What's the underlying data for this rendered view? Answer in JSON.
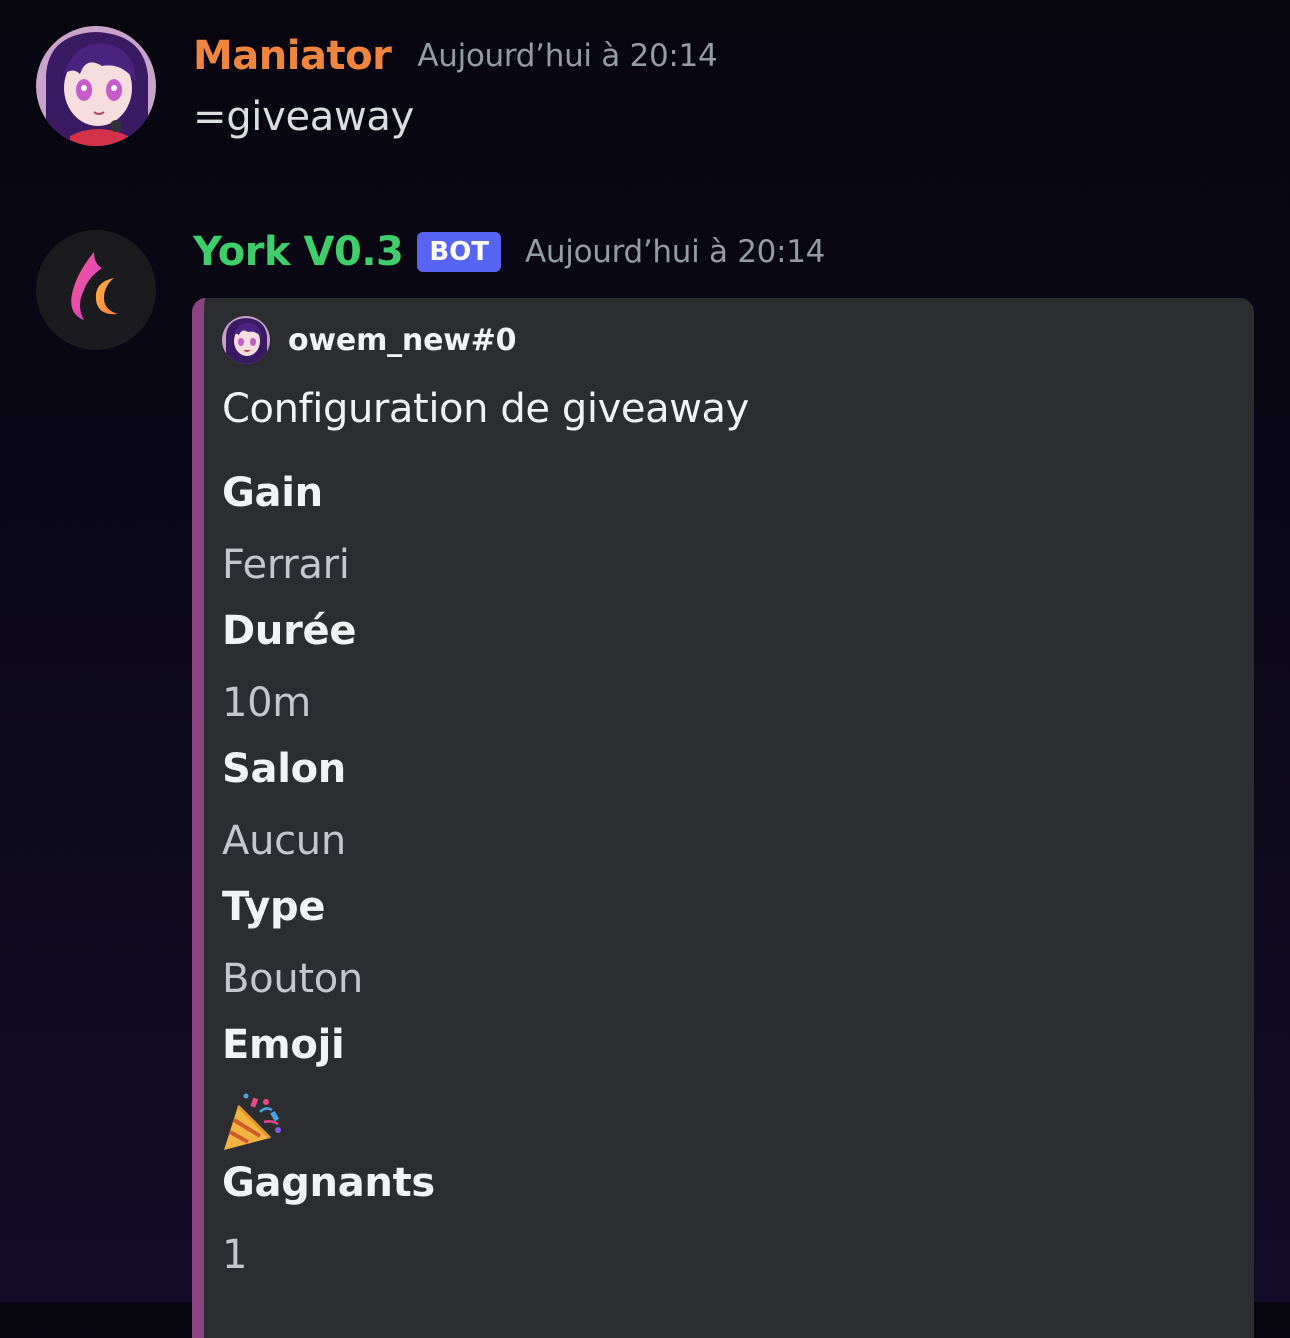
{
  "messages": {
    "user": {
      "username": "Maniator",
      "username_color": "#f0853e",
      "timestamp": "Aujourd’hui à 20:14",
      "content": "=giveaway",
      "avatar_icon": "anime-girl-avatar"
    },
    "bot": {
      "username": "York V0.3",
      "username_color": "#3ecf6b",
      "bot_tag": "BOT",
      "timestamp": "Aujourd’hui à 20:14",
      "avatar_icon": "flame-moon-logo",
      "embed": {
        "accent_color": "#8c4480",
        "author": {
          "name": "owem_new#0",
          "icon": "anime-girl-avatar"
        },
        "title": "Configuration de giveaway",
        "fields": [
          {
            "name": "Gain",
            "value": "Ferrari"
          },
          {
            "name": "Durée",
            "value": "10m"
          },
          {
            "name": "Salon",
            "value": "Aucun"
          },
          {
            "name": "Type",
            "value": "Bouton"
          },
          {
            "name": "Emoji",
            "value_icon": "party-popper-emoji"
          },
          {
            "name": "Gagnants",
            "value": "1"
          }
        ]
      }
    }
  }
}
